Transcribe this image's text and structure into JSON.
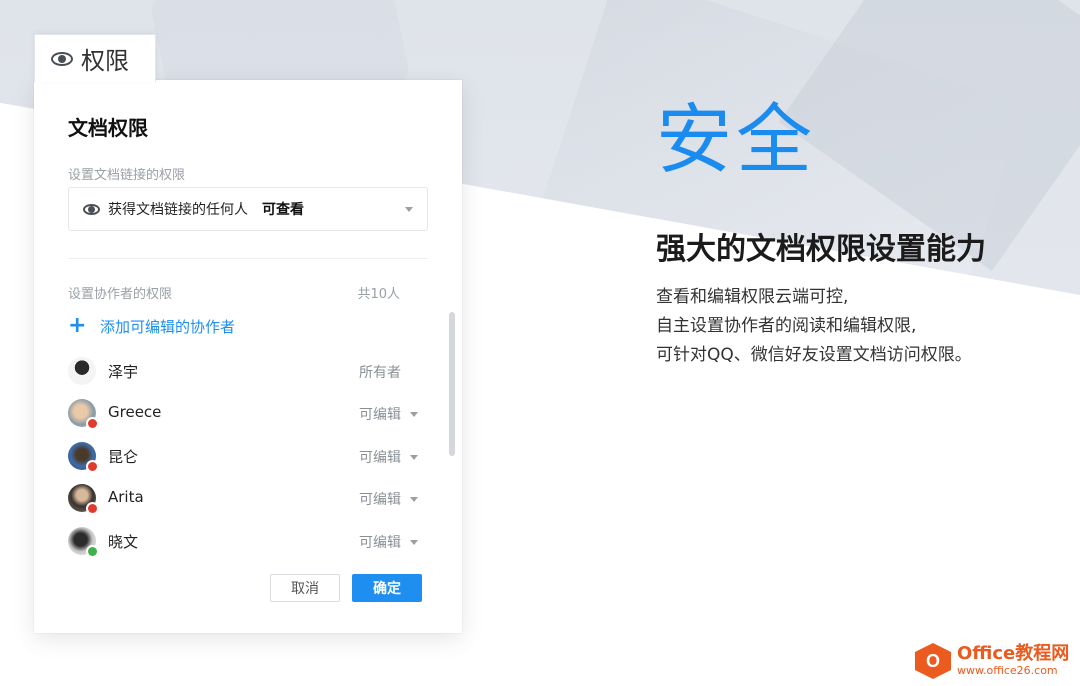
{
  "tab": {
    "icon": "eye-icon",
    "label": "权限"
  },
  "panel": {
    "title": "文档权限",
    "link_section_label": "设置文档链接的权限",
    "link_select": {
      "icon": "eye-icon",
      "text": "获得文档链接的任何人",
      "permission": "可查看"
    },
    "collab_section_label": "设置协作者的权限",
    "collab_count": "共10人",
    "add_collaborator": "添加可编辑的协作者",
    "members": [
      {
        "name": "泽宇",
        "role": "所有者",
        "badge": ""
      },
      {
        "name": "Greece",
        "role": "可编辑",
        "badge": "qq"
      },
      {
        "name": "昆仑",
        "role": "可编辑",
        "badge": "qq"
      },
      {
        "name": "Arita",
        "role": "可编辑",
        "badge": "qq"
      },
      {
        "name": "晓文",
        "role": "可编辑",
        "badge": "wechat"
      }
    ],
    "cancel_label": "取消",
    "ok_label": "确定"
  },
  "hero": {
    "headline": "安全",
    "subhead": "强大的文档权限设置能力",
    "lines": [
      "查看和编辑权限云端可控,",
      "自主设置协作者的阅读和编辑权限,",
      "可针对QQ、微信好友设置文档访问权限。"
    ]
  },
  "watermark": {
    "title": "Office教程网",
    "url": "www.office26.com",
    "logo_letter": "O"
  },
  "colors": {
    "accent": "#1f8ef1",
    "headline": "#1a8cf0",
    "watermark": "#eb5a1e"
  }
}
